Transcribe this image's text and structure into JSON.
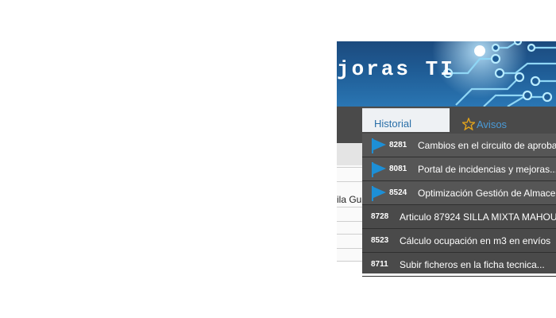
{
  "header": {
    "banner_title": "joras TI"
  },
  "tabs": {
    "historial_label": "Historial",
    "avisos_label": "Avisos",
    "avisos_icon": "star-icon"
  },
  "background_panel": {
    "name_fragment": "ila Gu"
  },
  "colors": {
    "banner": "#1f5c95",
    "nav_bar": "#4a4a4a",
    "flag": "#1d8fd6",
    "avisos_star": "#e0a21c"
  },
  "notifications": [
    {
      "id": "8281",
      "title": "Cambios en el circuito de aprobac",
      "flagged": true
    },
    {
      "id": "8081",
      "title": "Portal de incidencias y mejoras...",
      "flagged": true
    },
    {
      "id": "8524",
      "title": "Optimización Gestión de Almacen",
      "flagged": true
    },
    {
      "id": "8728",
      "title": "Articulo 87924 SILLA MIXTA MAHOU",
      "flagged": false
    },
    {
      "id": "8523",
      "title": "Cálculo ocupación en m3 en envíos",
      "flagged": false
    },
    {
      "id": "8711",
      "title": "Subir ficheros en la ficha tecnica...",
      "flagged": false
    }
  ]
}
